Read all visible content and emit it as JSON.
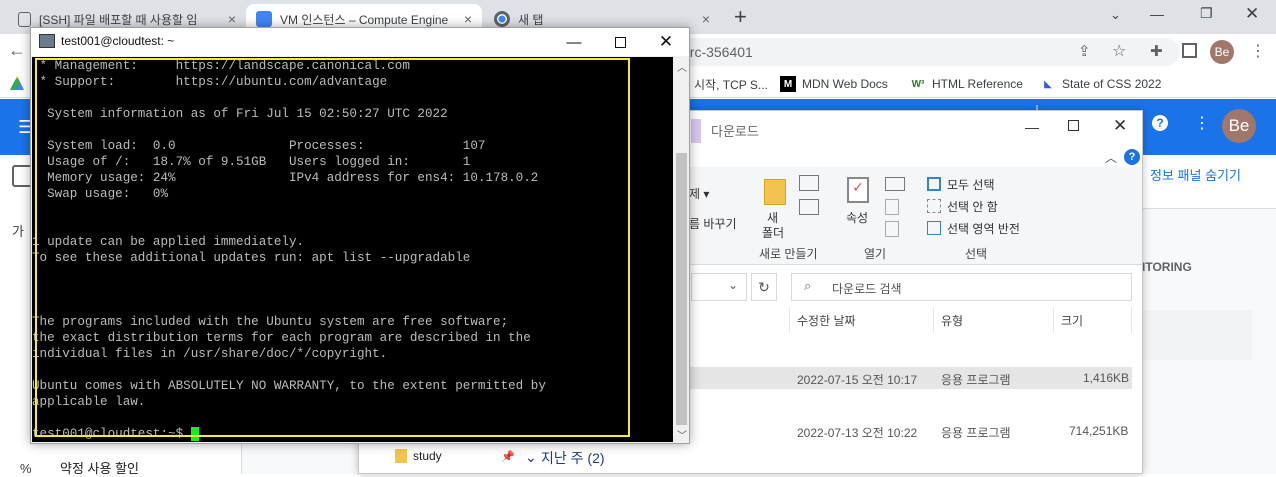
{
  "browser": {
    "tabs": [
      {
        "title": "[SSH] 파일 배포할 때 사용할 임",
        "close": "×"
      },
      {
        "title": "VM 인스턴스 – Compute Engine",
        "close": "×"
      },
      {
        "title": "새 탭",
        "close": "×"
      }
    ],
    "new_tab": "+",
    "url_fragment": "arc-356401",
    "profile": "Be",
    "bookmarks": [
      {
        "label": "시작, TCP S...",
        "icon": "bookmark-icon"
      },
      {
        "label": "MDN Web Docs",
        "icon": "mdn-icon"
      },
      {
        "label": "HTML Reference",
        "icon": "w3-icon"
      },
      {
        "label": "State of CSS 2022",
        "icon": "css-icon"
      }
    ]
  },
  "gcp": {
    "profile": "Be",
    "hide_panel": "정보 패널 숨기기",
    "monitoring": "ITORING",
    "side_item_1": "가",
    "side_item_bottom": "약정 사용 할인"
  },
  "explorer": {
    "title": "다운로드",
    "ribbon": {
      "delete_label": "제 ▾",
      "rename_label": "름 바꾸기",
      "new_folder": "새\n폴더",
      "new_folder_line1": "새",
      "new_folder_line2": "폴더",
      "new_group": "새로 만들기",
      "properties": "속성",
      "open_group": "열기",
      "select_all": "모두 선택",
      "select_none": "선택 안 함",
      "invert": "선택 영역 반전",
      "select_group": "선택"
    },
    "search_placeholder": "다운로드 검색",
    "columns": {
      "modified": "수정한 날짜",
      "type": "유형",
      "size": "크기"
    },
    "rows": [
      {
        "date": "2022-07-15 오전 10:17",
        "type": "응용 프로그램",
        "size": "1,416KB"
      },
      {
        "date": "2022-07-13 오전 10:22",
        "type": "응용 프로그램",
        "size": "714,251KB"
      }
    ],
    "nav_item": "study",
    "group_header": "지난 주 (2)"
  },
  "putty": {
    "title": "test001@cloudtest: ~",
    "lines": [
      " * Management:     https://landscape.canonical.com",
      " * Support:        https://ubuntu.com/advantage",
      "",
      "  System information as of Fri Jul 15 02:50:27 UTC 2022",
      "",
      "  System load:  0.0               Processes:             107",
      "  Usage of /:   18.7% of 9.51GB   Users logged in:       1",
      "  Memory usage: 24%               IPv4 address for ens4: 10.178.0.2",
      "  Swap usage:   0%",
      "",
      "",
      "1 update can be applied immediately.",
      "To see these additional updates run: apt list --upgradable",
      "",
      "",
      "",
      "The programs included with the Ubuntu system are free software;",
      "the exact distribution terms for each program are described in the",
      "individual files in /usr/share/doc/*/copyright.",
      "",
      "Ubuntu comes with ABSOLUTELY NO WARRANTY, to the extent permitted by",
      "applicable law.",
      "",
      "test001@cloudtest:~$ "
    ],
    "colors": {
      "text": "#bbbbbb",
      "background": "#000000",
      "cursor": "#00ff00",
      "highlight_border": "#f4e842"
    }
  }
}
